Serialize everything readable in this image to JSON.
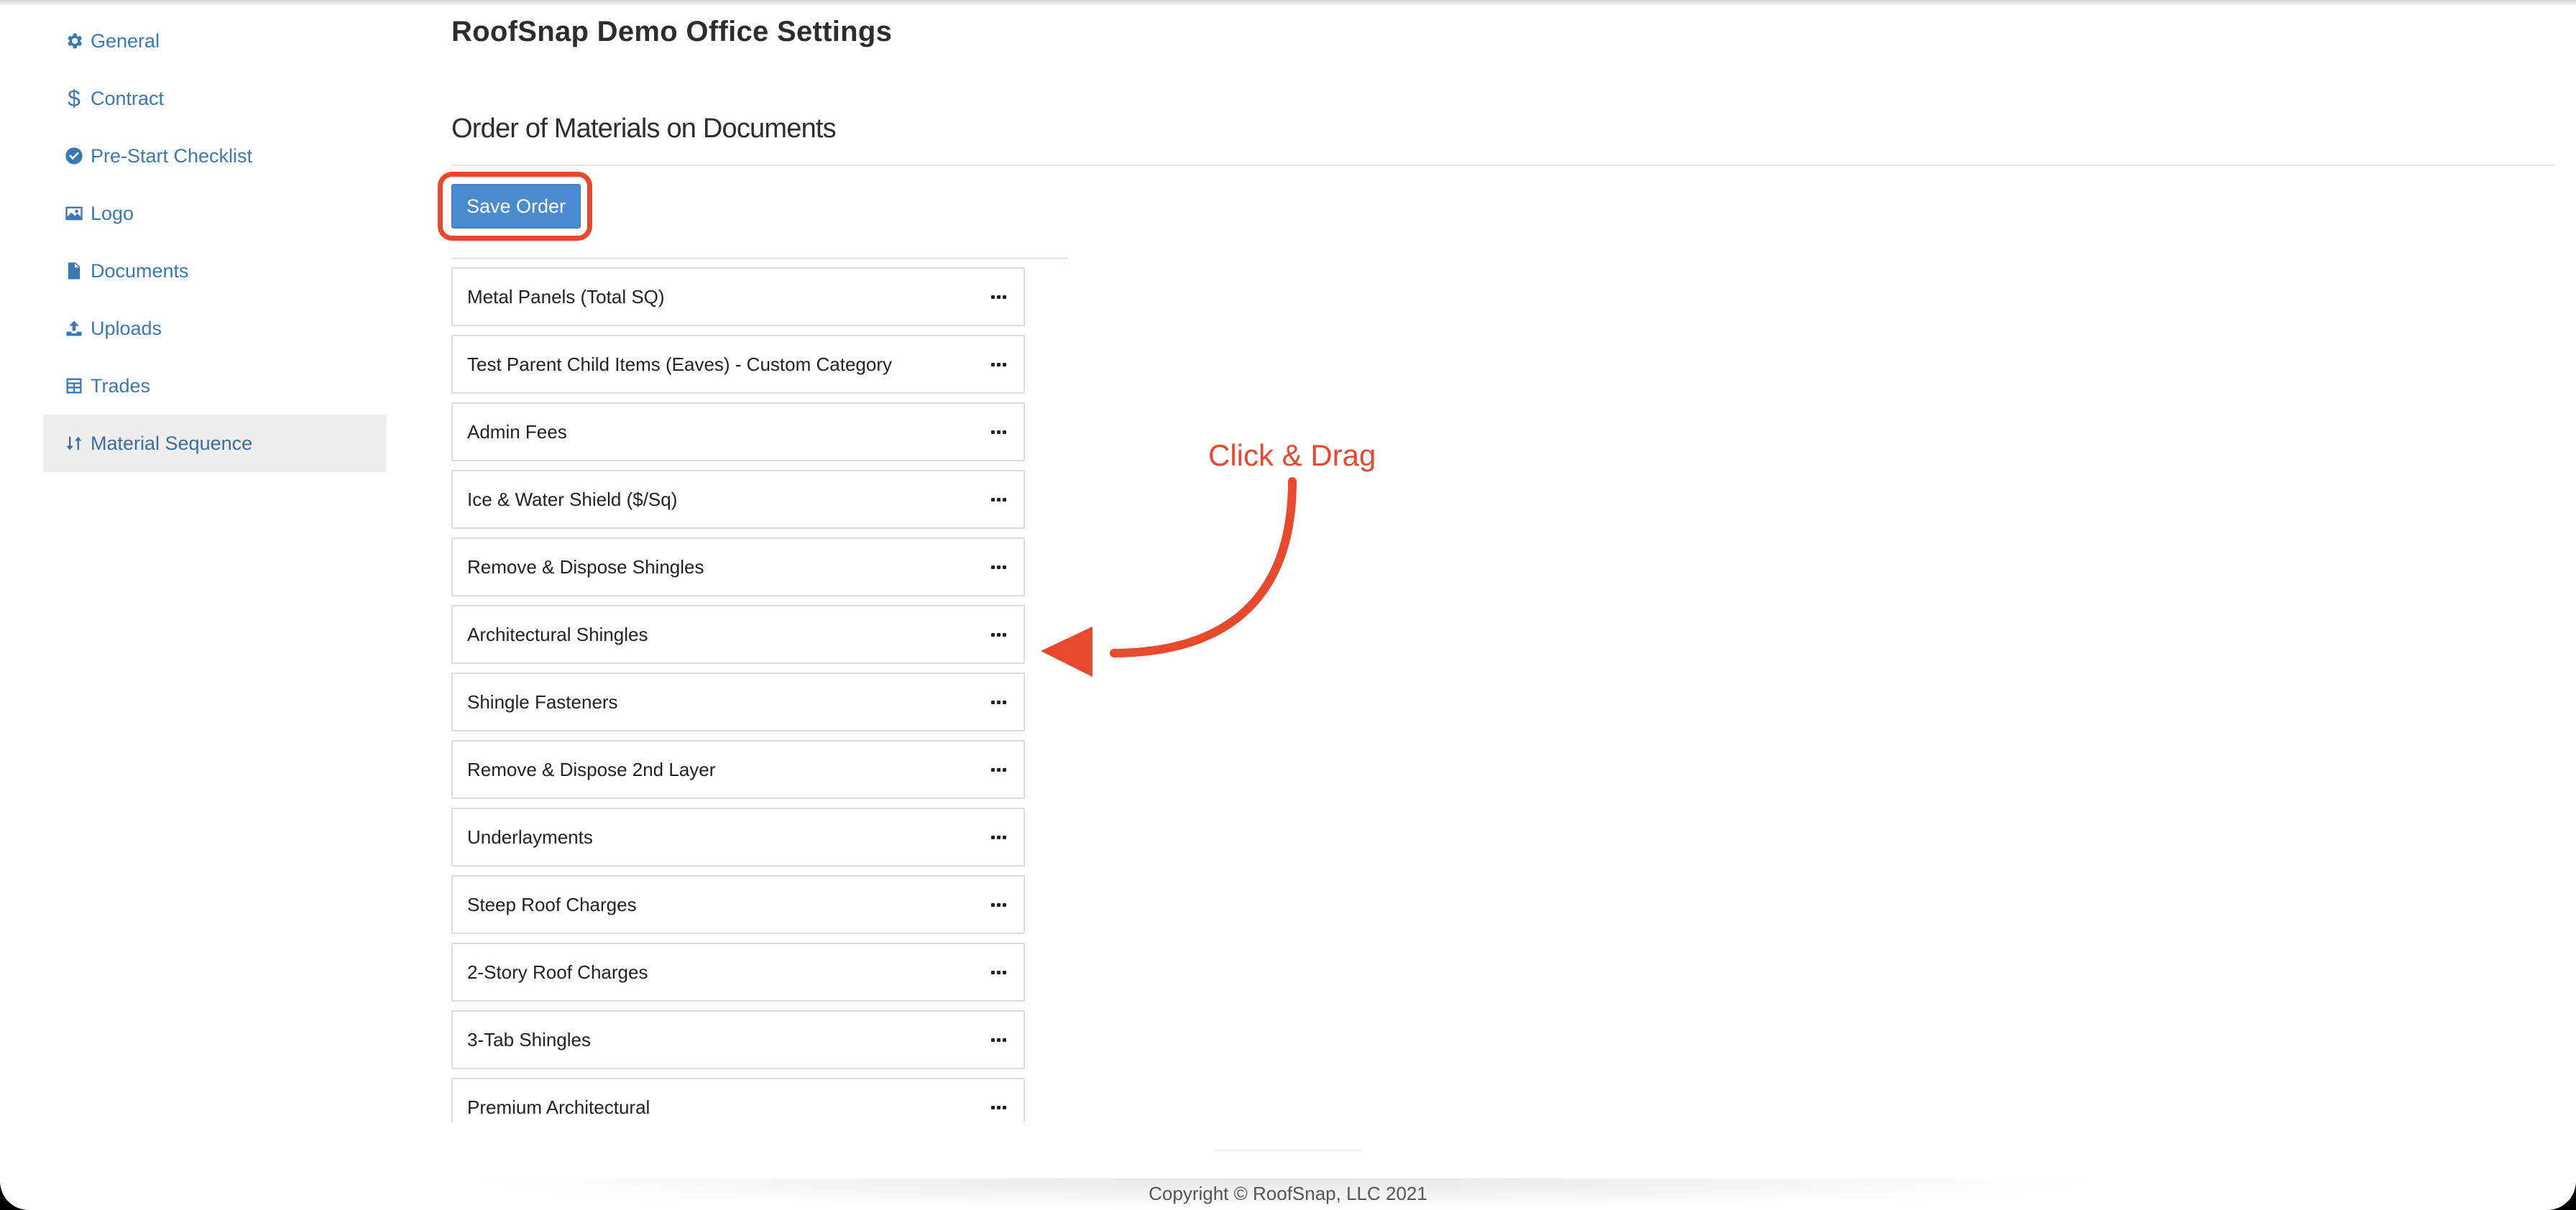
{
  "sidebar": {
    "items": [
      {
        "label": "General",
        "icon": "gear-icon"
      },
      {
        "label": "Contract",
        "icon": "dollar-icon"
      },
      {
        "label": "Pre-Start Checklist",
        "icon": "check-circle-icon"
      },
      {
        "label": "Logo",
        "icon": "image-icon"
      },
      {
        "label": "Documents",
        "icon": "file-icon"
      },
      {
        "label": "Uploads",
        "icon": "upload-icon"
      },
      {
        "label": "Trades",
        "icon": "table-icon"
      },
      {
        "label": "Material Sequence",
        "icon": "sort-arrows-icon",
        "active": true
      }
    ]
  },
  "main": {
    "title": "RoofSnap Demo Office Settings",
    "section_heading": "Order of Materials on Documents",
    "save_label": "Save Order",
    "materials": [
      "Metal Panels (Total SQ)",
      "Test Parent Child Items (Eaves) - Custom Category",
      "Admin Fees",
      "Ice & Water Shield ($/Sq)",
      "Remove & Dispose Shingles",
      "Architectural Shingles",
      "Shingle Fasteners",
      "Remove & Dispose 2nd Layer",
      "Underlayments",
      "Steep Roof Charges",
      "2-Story Roof Charges",
      "3-Tab Shingles",
      "Premium Architectural"
    ]
  },
  "annotation": {
    "text": "Click & Drag",
    "color": "#e8492d"
  },
  "footer": {
    "copyright": "Copyright © RoofSnap, LLC 2021"
  },
  "colors": {
    "accent": "#4a8ad0",
    "link": "#3a78b5",
    "highlight": "#e8492d"
  }
}
